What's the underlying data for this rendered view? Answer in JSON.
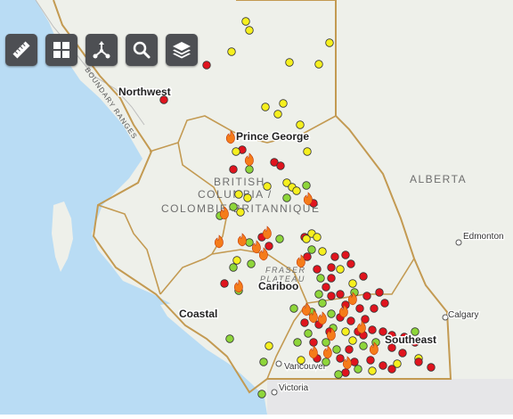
{
  "toolbar": {
    "tools": [
      {
        "name": "measure-tool-button",
        "icon": "ruler-icon"
      },
      {
        "name": "basemap-tool-button",
        "icon": "grid-icon"
      },
      {
        "name": "share-tool-button",
        "icon": "share-icon"
      },
      {
        "name": "search-tool-button",
        "icon": "search-icon"
      },
      {
        "name": "layers-tool-button",
        "icon": "layers-icon"
      }
    ]
  },
  "map": {
    "regions": {
      "northwest": "Northwest",
      "prince_george": "Prince George",
      "cariboo": "Cariboo",
      "coastal": "Coastal",
      "southeast": "Southeast"
    },
    "province_label_line1": "BRITISH",
    "province_label_line2": "COLUMBIA /",
    "province_label_line3": "COLOMBIE-BRITANNIQUE",
    "alberta_label": "ALBERTA",
    "range_label": "BOUNDARY RANGES",
    "plateau_label_line1": "FRASER",
    "plateau_label_line2": "PLATEAU",
    "cities": {
      "edmonton": "Edmonton",
      "calgary": "Calgary",
      "vancouver": "Vancouver",
      "victoria": "Victoria"
    },
    "colors": {
      "land": "#eef0ea",
      "water": "#b9dcf4",
      "boundary": "#c39a52",
      "fire_red": "#e0141e",
      "fire_yellow": "#f6f01e",
      "fire_green": "#8ed63a",
      "fire_orange": "#f57c1a"
    }
  }
}
